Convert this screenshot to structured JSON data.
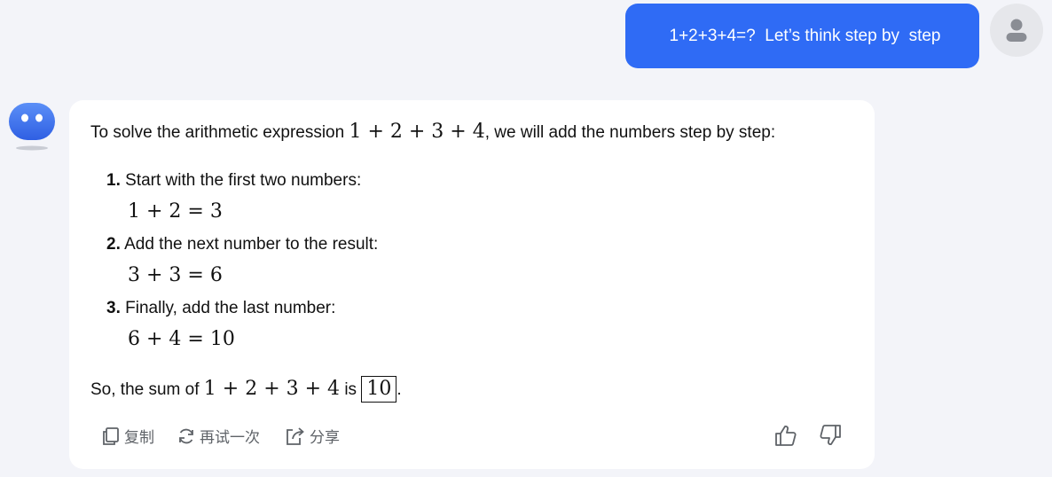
{
  "user_message": "1+2+3+4=?  Let’s think step by  step",
  "assistant": {
    "intro_before": "To solve the arithmetic expression ",
    "intro_math": "1 + 2 + 3 + 4",
    "intro_after": ", we will add the numbers step by step:",
    "steps": [
      {
        "num": "1.",
        "text": "Start with the first two numbers:",
        "math": "1 + 2 = 3"
      },
      {
        "num": "2.",
        "text": "Add the next number to the result:",
        "math": "3 + 3 = 6"
      },
      {
        "num": "3.",
        "text": "Finally, add the last number:",
        "math": "6 + 4 = 10"
      }
    ],
    "conclusion_before": "So, the sum of ",
    "conclusion_math": "1 + 2 + 3 + 4",
    "conclusion_mid": " is ",
    "conclusion_result": "10",
    "conclusion_after": "."
  },
  "actions": {
    "copy_label": "复制",
    "retry_label": "再试一次",
    "share_label": "分享"
  },
  "icons": [
    "user-avatar-icon",
    "bot-avatar-icon",
    "copy-icon",
    "retry-icon",
    "share-icon",
    "thumbs-up-icon",
    "thumbs-down-icon"
  ],
  "colors": {
    "accent": "#2f6bf5",
    "background": "#f3f4f9",
    "card": "#ffffff",
    "action": "#5f6368"
  }
}
